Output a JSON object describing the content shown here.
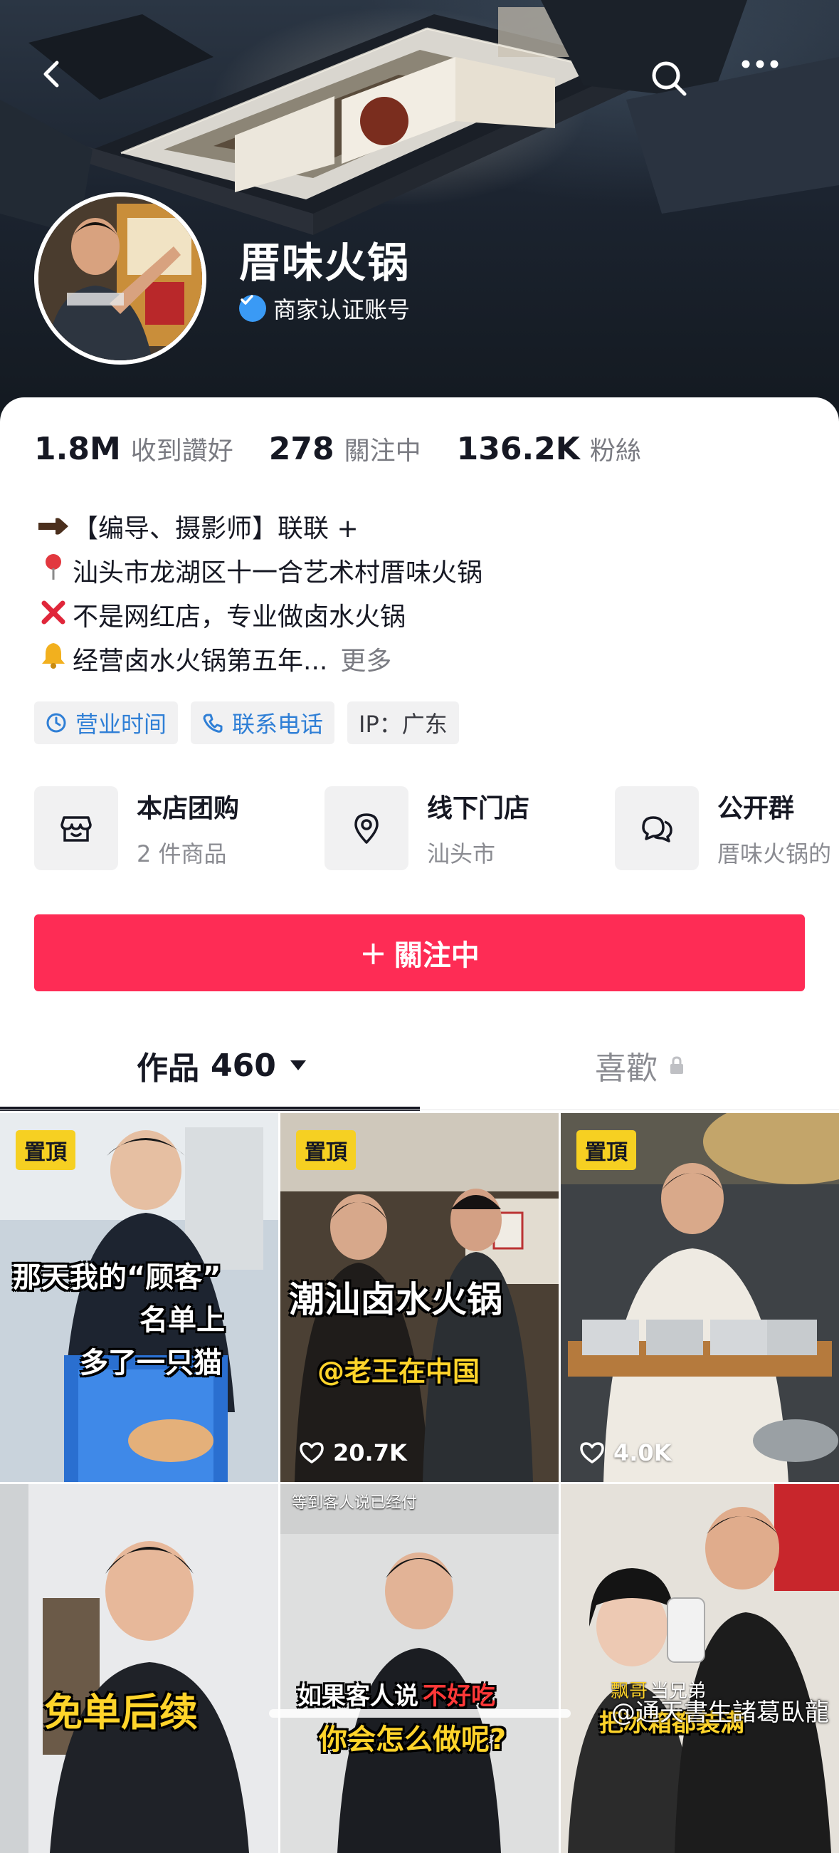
{
  "profile": {
    "name": "厝味火锅",
    "verified_label": "商家认证账号"
  },
  "stats": [
    {
      "value": "1.8M",
      "label": "收到讚好"
    },
    {
      "value": "278",
      "label": "關注中"
    },
    {
      "value": "136.2K",
      "label": "粉絲"
    }
  ],
  "bio": {
    "line1": "【编导、摄影师】联联 +",
    "line2": "汕头市龙湖区十一合艺术村厝味火锅",
    "line3": "不是网红店，专业做卤水火锅",
    "line4": "经营卤水火锅第五年...",
    "more": "更多"
  },
  "tags": {
    "hours": "营业时间",
    "phone": "联系电话",
    "ip": "IP：广东"
  },
  "cards": [
    {
      "title": "本店团购",
      "subtitle": "2 件商品",
      "icon": "shop-icon"
    },
    {
      "title": "线下门店",
      "subtitle": "汕头市",
      "icon": "location-pin-icon"
    },
    {
      "title": "公开群",
      "subtitle": "厝味火锅的",
      "icon": "chat-bubbles-icon"
    }
  ],
  "follow_button": {
    "plus": "+",
    "label": "關注中"
  },
  "tabs": {
    "works_label": "作品",
    "works_count": "460",
    "likes_label": "喜歡"
  },
  "videos": [
    {
      "pinned": "置頂",
      "caption1": "那天我的“顾客”",
      "caption2": "名单上",
      "caption3": "多了一只猫"
    },
    {
      "pinned": "置頂",
      "caption1": "潮汕卤水火锅",
      "caption2": "@老王在中国",
      "likes": "20.7K"
    },
    {
      "pinned": "置頂",
      "likes": "4.0K"
    },
    {
      "caption1": "免单后续"
    },
    {
      "top_text": "等到客人说已经付",
      "caption_white": "如果客人说",
      "caption_yellow": "不好吃",
      "caption2": "你会怎么做呢?"
    },
    {
      "caption_small": "飘哥",
      "caption_small2": "当兄弟",
      "caption_yellow": "把冰箱都装满"
    }
  ],
  "watermark": "@通天書生諸葛臥龍",
  "colors": {
    "accent": "#fe2c55",
    "link": "#2f7fd6",
    "pin": "#f6d022",
    "verify": "#3a9af5"
  }
}
